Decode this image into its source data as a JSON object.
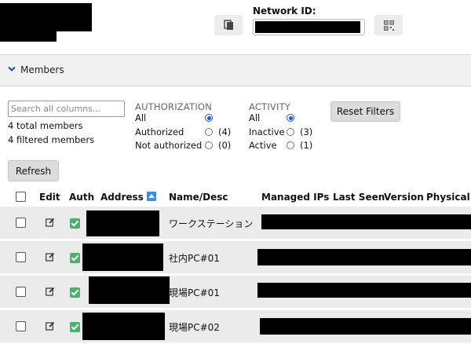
{
  "header": {
    "network_id_label": "Network ID:",
    "network_id_value": "",
    "copy_icon": "copy-icon",
    "qr_icon": "qr-code-icon"
  },
  "members_section": {
    "title": "Members",
    "expanded": true
  },
  "filters": {
    "search_placeholder": "Search all columns...",
    "total_members": "4 total members",
    "filtered_members": "4 filtered members",
    "authorization": {
      "title": "AUTHORIZATION",
      "options": [
        {
          "label": "All",
          "count": "",
          "selected": true
        },
        {
          "label": "Authorized",
          "count": "(4)",
          "selected": false
        },
        {
          "label": "Not authorized",
          "count": "(0)",
          "selected": false
        }
      ]
    },
    "activity": {
      "title": "ACTIVITY",
      "options": [
        {
          "label": "All",
          "count": "",
          "selected": true
        },
        {
          "label": "Inactive",
          "count": "(3)",
          "selected": false
        },
        {
          "label": "Active",
          "count": "(1)",
          "selected": false
        }
      ]
    },
    "reset_label": "Reset Filters",
    "refresh_label": "Refresh"
  },
  "table": {
    "columns": [
      "Edit",
      "Auth",
      "Address",
      "Name/Desc",
      "Managed IPs",
      "Last Seen",
      "Version",
      "Physical IP"
    ],
    "rows": [
      {
        "name": "ワークステーション",
        "authorized": true
      },
      {
        "name": "社内PC#01",
        "authorized": true
      },
      {
        "name": "現場PC#01",
        "authorized": true
      },
      {
        "name": "現場PC#02",
        "authorized": true
      }
    ]
  },
  "colors": {
    "accent": "#1a56e8",
    "sort_icon": "#3d8be8",
    "auth_ok": "#4caf6a",
    "row_bg": "#ebebeb",
    "redaction": "#000000"
  }
}
